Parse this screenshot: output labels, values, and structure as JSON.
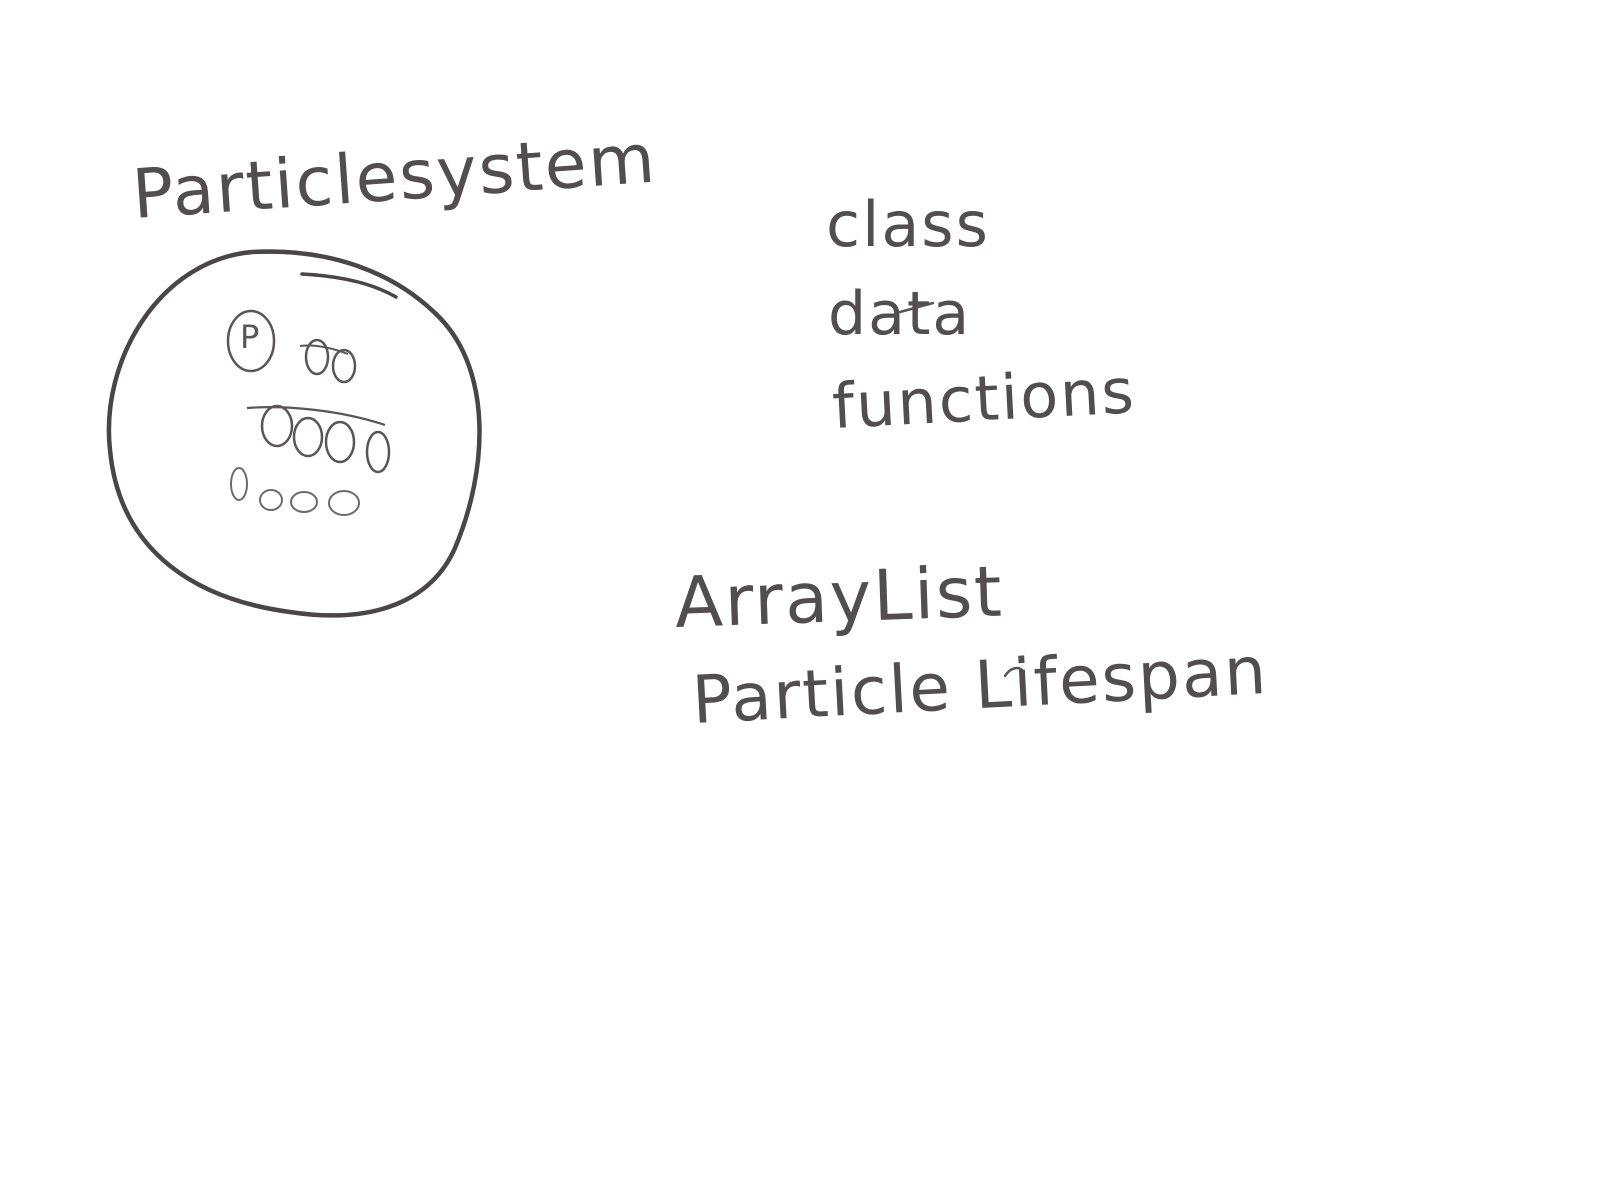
{
  "colors": {
    "background": "#ffffff",
    "ink_dark": "#4a4546",
    "ink_medium": "#5a5556",
    "ink_light": "#6e6a6b"
  },
  "sketch": {
    "title": "Particlesystem",
    "particle_marker_letter": "P",
    "notes": [
      "class",
      "data",
      "functions"
    ],
    "terms": [
      "ArrayList",
      "Particle Lifespan"
    ]
  }
}
